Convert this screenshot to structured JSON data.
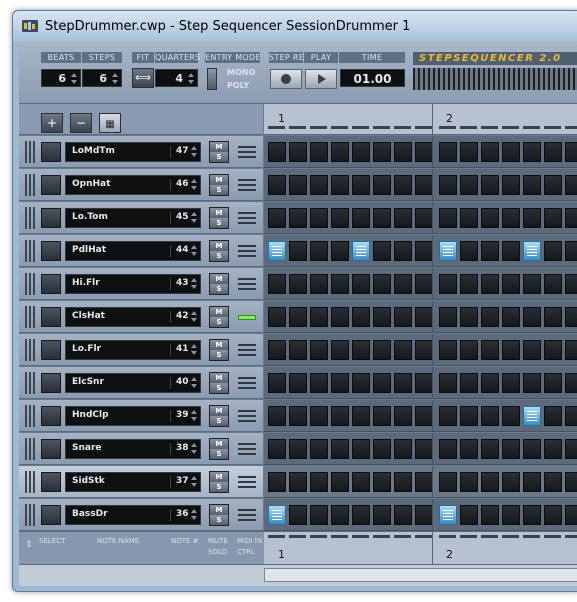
{
  "window": {
    "title": "StepDrummer.cwp - Step Sequencer SessionDrummer 1"
  },
  "toolbar": {
    "beats_label": "BEATS",
    "steps_label": "STEPS",
    "beats_value": "6",
    "steps_value": "6",
    "fit_label": "FIT",
    "quarters_label": "QUARTERS",
    "quarters_value": "4",
    "entry_mode_label": "ENTRY MODE",
    "mono_label": "MONO",
    "poly_label": "POLY",
    "step_rec_label": "STEP REC",
    "play_label": "PLAY",
    "time_label": "TIME",
    "time_value": "01.00",
    "brand": "STEPSEQUENCER 2.0"
  },
  "ruler": {
    "bar_1": "1",
    "bar_2": "2"
  },
  "tracks": [
    {
      "name": "LoMdTm",
      "note": "47",
      "m": "M",
      "s": "S",
      "steps_on": []
    },
    {
      "name": "OpnHat",
      "note": "46",
      "m": "M",
      "s": "S",
      "steps_on": []
    },
    {
      "name": "Lo.Tom",
      "note": "45",
      "m": "M",
      "s": "S",
      "steps_on": []
    },
    {
      "name": "PdlHat",
      "note": "44",
      "m": "M",
      "s": "S",
      "steps_on": [
        0,
        4,
        8,
        12
      ]
    },
    {
      "name": "Hi.Flr",
      "note": "43",
      "m": "M",
      "s": "S",
      "steps_on": []
    },
    {
      "name": "ClsHat",
      "note": "42",
      "m": "M",
      "s": "S",
      "steps_on": [],
      "midi_active": true
    },
    {
      "name": "Lo.Flr",
      "note": "41",
      "m": "M",
      "s": "S",
      "steps_on": []
    },
    {
      "name": "ElcSnr",
      "note": "40",
      "m": "M",
      "s": "S",
      "steps_on": []
    },
    {
      "name": "HndClp",
      "note": "39",
      "m": "M",
      "s": "S",
      "steps_on": [
        12
      ]
    },
    {
      "name": "Snare",
      "note": "38",
      "m": "M",
      "s": "S",
      "steps_on": []
    },
    {
      "name": "SidStk",
      "note": "37",
      "m": "M",
      "s": "S",
      "steps_on": [],
      "highlight": true
    },
    {
      "name": "BassDr",
      "note": "36",
      "m": "M",
      "s": "S",
      "steps_on": [
        0,
        8
      ]
    }
  ],
  "footer": {
    "select_label": "SELECT",
    "note_name_label": "NOTE NAME",
    "note_num_label": "NOTE #",
    "mute_label": "MUTE",
    "solo_label": "SOLO",
    "midi_in_label": "MIDI IN",
    "ctrl_label": "CTRL",
    "bar_1": "1",
    "bar_2": "2"
  }
}
